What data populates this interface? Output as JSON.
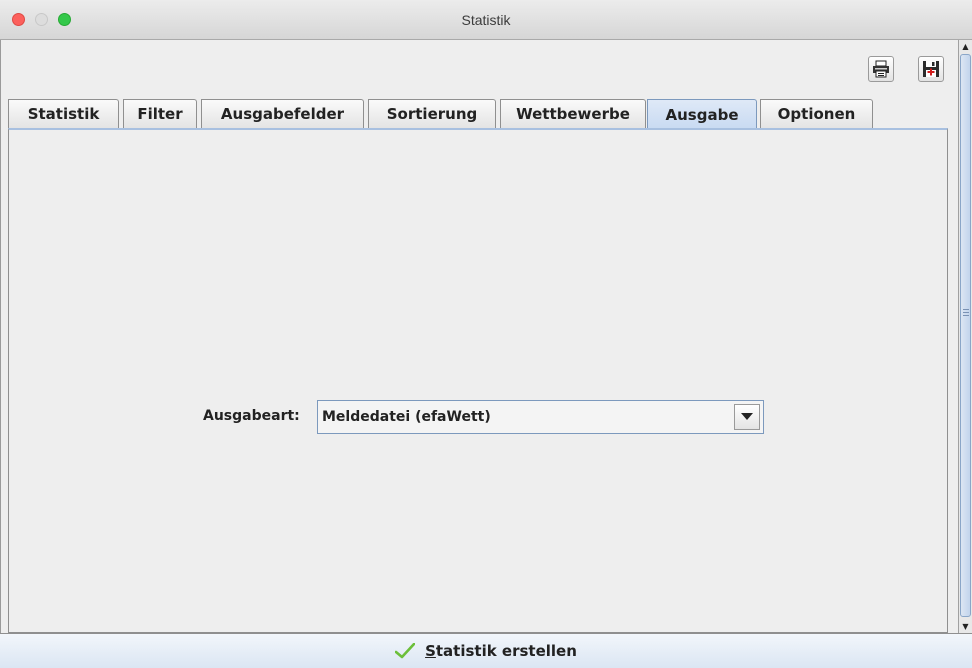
{
  "window": {
    "title": "Statistik"
  },
  "toolbar": {
    "print_icon": "printer-icon",
    "save_icon": "save-disk-icon"
  },
  "tabs": [
    {
      "label": "Statistik",
      "active": false
    },
    {
      "label": "Filter",
      "active": false
    },
    {
      "label": "Ausgabefelder",
      "active": false
    },
    {
      "label": "Sortierung",
      "active": false
    },
    {
      "label": "Wettbewerbe",
      "active": false
    },
    {
      "label": "Ausgabe",
      "active": true
    },
    {
      "label": "Optionen",
      "active": false
    }
  ],
  "ausgabe": {
    "ausgabeart_label": "Ausgabeart:",
    "ausgabeart_value": "Meldedatei (efaWett)"
  },
  "footer": {
    "run_button_label_first": "S",
    "run_button_label_rest": "tatistik erstellen",
    "run_button_icon": "checkmark-icon",
    "accent_color": "#6cbf3a"
  }
}
